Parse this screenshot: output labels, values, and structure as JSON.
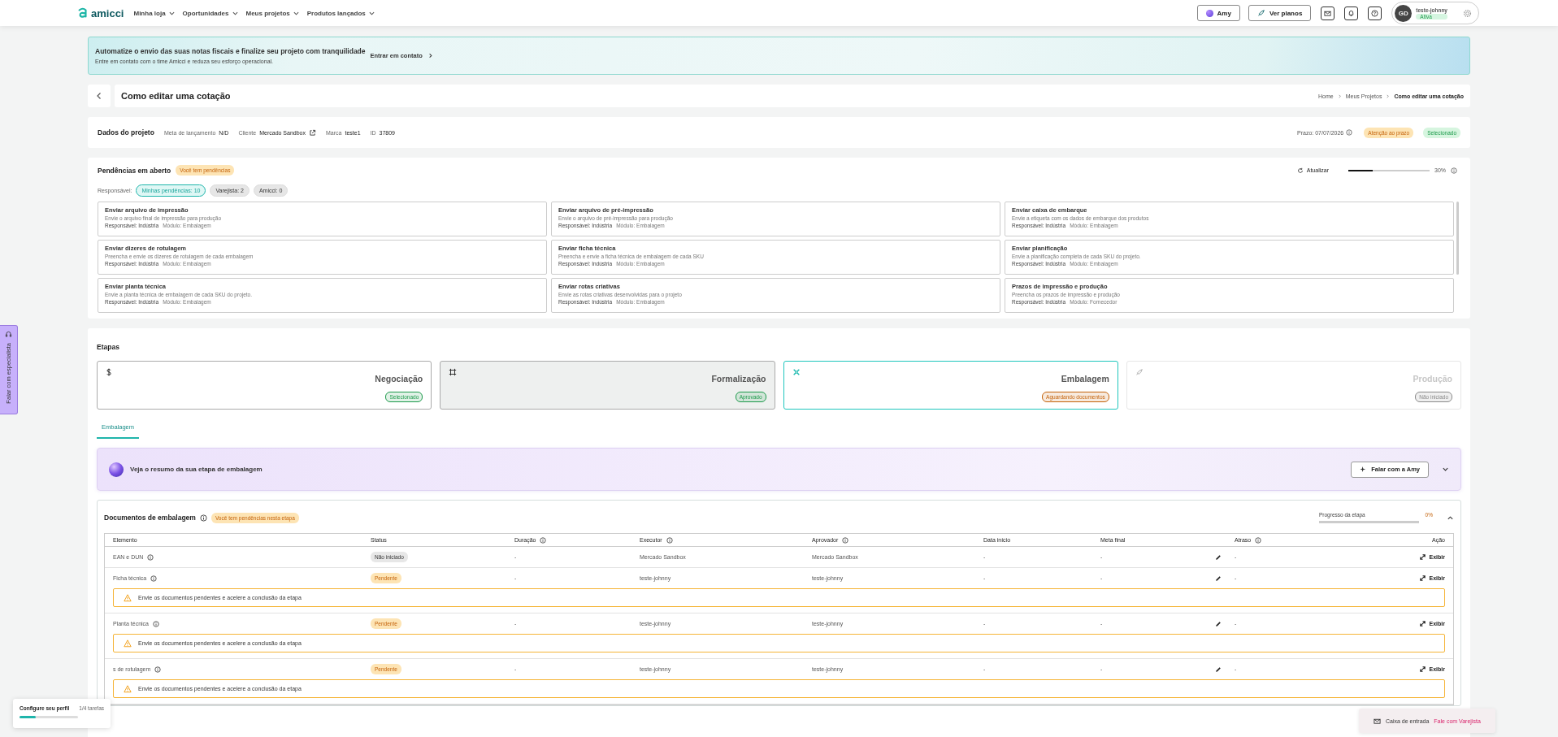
{
  "nav": {
    "brand": "amicci",
    "menus": [
      {
        "label": "Minha loja"
      },
      {
        "label": "Oportunidades"
      },
      {
        "label": "Meus projetos"
      },
      {
        "label": "Produtos lançados"
      }
    ]
  },
  "header": {
    "amy": "Amy",
    "plans": "Ver planos",
    "user": {
      "initials": "GD",
      "name": "teste-johnny",
      "status": "Ativa"
    }
  },
  "banner": {
    "title": "Automatize o envio das suas notas fiscais e finalize seu projeto com tranquilidade",
    "text": "Entre em contato com o time Amicci e reduza seu esforço operacional.",
    "action": "Entrar em contato"
  },
  "page": {
    "title": "Como editar uma cotação",
    "breadcrumbs": [
      "Home",
      "Meus Projetos",
      "Como editar uma cotação"
    ]
  },
  "project": {
    "title": "Dados do projeto",
    "fields": [
      {
        "label": "Meta de lançamento",
        "value": "N/D",
        "kind": "text"
      },
      {
        "label": "Cliente",
        "value": "Mercado Sandbox",
        "kind": "link"
      },
      {
        "label": "Marca",
        "value": "teste1",
        "kind": "text"
      },
      {
        "label": "ID",
        "value": "37809",
        "kind": "text"
      }
    ],
    "deadline": "Prazo: 07/07/2026",
    "badges": [
      {
        "text": "Atenção ao prazo",
        "kind": "warning"
      },
      {
        "text": "Selecionado",
        "kind": "success"
      }
    ]
  },
  "pending": {
    "title": "Pendências em aberto",
    "badge": "Você tem pendências",
    "refresh": "Atualizar",
    "level": 0.3,
    "reading": "30%",
    "filter_label": "Responsável:",
    "filters": [
      {
        "label": "Minhas pendências: 10",
        "selected": true
      },
      {
        "label": "Varejista: 2",
        "selected": false
      },
      {
        "label": "Amicci: 0",
        "selected": false
      }
    ],
    "items": [
      {
        "title": "Enviar arquivo de impressão",
        "text": "Envie o arquivo final de impressão para produção",
        "owner": "Responsável: Indústria",
        "module": "Módulo: Embalagem"
      },
      {
        "title": "Enviar arquivo de pré-impressão",
        "text": "Envie o arquivo de pré-impressão para produção",
        "owner": "Responsável: Indústria",
        "module": "Módulo: Embalagem"
      },
      {
        "title": "Enviar caixa de embarque",
        "text": "Envie a etiqueta com os dados de embarque dos produtos",
        "owner": "Responsável: Indústria",
        "module": "Módulo: Embalagem"
      },
      {
        "title": "Enviar dizeres de rotulagem",
        "text": "Preencha e envie os dizeres de rotulagem de cada embalagem",
        "owner": "Responsável: Indústria",
        "module": "Módulo: Embalagem"
      },
      {
        "title": "Enviar ficha técnica",
        "text": "Preencha e envie a ficha técnica de embalagem de cada SKU",
        "owner": "Responsável: Indústria",
        "module": "Módulo: Embalagem"
      },
      {
        "title": "Enviar planificação",
        "text": "Envie a planificação completa de cada SKU do projeto.",
        "owner": "Responsável: Indústria",
        "module": "Módulo: Embalagem"
      },
      {
        "title": "Enviar planta técnica",
        "text": "Envie a planta técnica de embalagem de cada SKU do projeto.",
        "owner": "Responsável: Indústria",
        "module": "Módulo: Embalagem"
      },
      {
        "title": "Enviar rotas criativas",
        "text": "Envie as rotas criativas desenvolvidas para o projeto",
        "owner": "Responsável: Indústria",
        "module": "Módulo: Embalagem"
      },
      {
        "title": "Prazos de impressão e produção",
        "text": "Preencha os prazos de impressão e produção",
        "owner": "Responsável: Indústria",
        "module": "Módulo: Fornecedor"
      }
    ]
  },
  "stages": {
    "title": "Etapas",
    "items": [
      {
        "name": "Negociação",
        "kind": "negotiation",
        "status": "Selecionado",
        "color": "#1d9a4b",
        "selected": false,
        "shaded": false,
        "disabled": false
      },
      {
        "name": "Formalização",
        "kind": "formalization",
        "status": "Aprovado",
        "color": "#1d9a4b",
        "selected": false,
        "shaded": true,
        "disabled": false
      },
      {
        "name": "Embalagem",
        "kind": "packaging",
        "status": "Aguardando documentos",
        "color": "#c4620a",
        "selected": true,
        "shaded": false,
        "disabled": false
      },
      {
        "name": "Produção",
        "kind": "production",
        "status": "Não iniciado",
        "color": "#8a8a8a",
        "selected": false,
        "shaded": false,
        "disabled": true
      }
    ]
  },
  "tabs": [
    {
      "label": "Embalagem",
      "selected": true
    }
  ],
  "amy": {
    "text": "Veja o resumo da sua etapa de embalagem",
    "button": "Falar com a Amy"
  },
  "documents": {
    "title": "Documentos de embalagem",
    "badge": "Você tem pendências nesta etapa",
    "progress_label": "Progresso da etapa",
    "level": 0,
    "reading": "0%",
    "columns": [
      {
        "label": "Elemento",
        "info": false
      },
      {
        "label": "Status",
        "info": false
      },
      {
        "label": "Duração",
        "info": true
      },
      {
        "label": "Executor",
        "info": true
      },
      {
        "label": "Aprovador",
        "info": true
      },
      {
        "label": "Data início",
        "info": false
      },
      {
        "label": "Meta final",
        "info": false
      },
      {
        "label": "Atraso",
        "info": true
      },
      {
        "label": "Ação",
        "info": false
      }
    ],
    "rows": [
      {
        "element": "EAN e DUN",
        "status": "Não iniciado",
        "kind": "idle",
        "duration": "-",
        "executor": "Mercado Sandbox",
        "approver": "Mercado Sandbox",
        "start": "-",
        "goal": "-",
        "delay": "-",
        "action": "Exibir"
      },
      {
        "element": "Ficha técnica",
        "status": "Pendente",
        "kind": "pending",
        "duration": "-",
        "executor": "teste-johnny",
        "approver": "teste-johnny",
        "start": "-",
        "goal": "-",
        "delay": "-",
        "action": "Exibir",
        "warning": "Envie os documentos pendentes e acelere a conclusão da etapa"
      },
      {
        "element": "Planta técnica",
        "status": "Pendente",
        "kind": "pending",
        "duration": "-",
        "executor": "teste-johnny",
        "approver": "teste-johnny",
        "start": "-",
        "goal": "-",
        "delay": "-",
        "action": "Exibir",
        "warning": "Envie os documentos pendentes e acelere a conclusão da etapa"
      },
      {
        "element": "s de rotulagem",
        "status": "Pendente",
        "kind": "pending",
        "duration": "-",
        "executor": "teste-johnny",
        "approver": "teste-johnny",
        "start": "-",
        "goal": "-",
        "delay": "-",
        "action": "Exibir",
        "warning": "Envie os documentos pendentes e acelere a conclusão da etapa"
      }
    ]
  },
  "side_tab": "Falar com especialista",
  "profile_widget": {
    "title": "Configure seu perfil",
    "tasks": "1/4 tarefas",
    "level": 0.28
  },
  "inbox": {
    "label": "Caixa de entrada",
    "link": "Fale com Varejista"
  }
}
